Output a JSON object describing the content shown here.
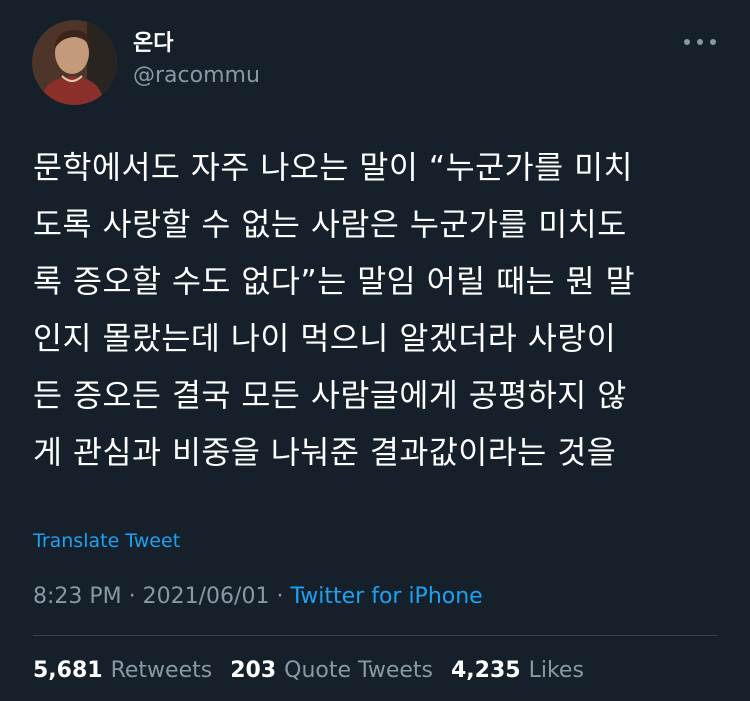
{
  "author": {
    "display_name": "온다",
    "handle": "@racommu"
  },
  "tweet": {
    "lines": [
      "문학에서도 자주 나오는 말이 “누군가를 미치",
      "도록 사랑할 수 없는 사람은 누군가를 미치도",
      "록 증오할 수도 없다”는 말임 어릴 때는 뭔 말",
      "인지 몰랐는데 나이 먹으니 알겠더라 사랑이",
      "든 증오든 결국 모든 사람글에게 공평하지 않",
      "게 관심과 비중을 나눠준 결과값이라는 것을"
    ],
    "translate_label": "Translate Tweet",
    "time": "8:23 PM",
    "separator": "·",
    "date": "2021/06/01",
    "source": "Twitter for iPhone"
  },
  "stats": {
    "retweets": {
      "count": "5,681",
      "label": "Retweets"
    },
    "quotes": {
      "count": "203",
      "label": "Quote Tweets"
    },
    "likes": {
      "count": "4,235",
      "label": "Likes"
    }
  },
  "colors": {
    "background": "#15202b",
    "text": "#ffffff",
    "secondary": "#8899a6",
    "accent": "#1da1f2",
    "divider": "#38444d"
  },
  "icons": {
    "more": "more-horizontal-icon"
  }
}
